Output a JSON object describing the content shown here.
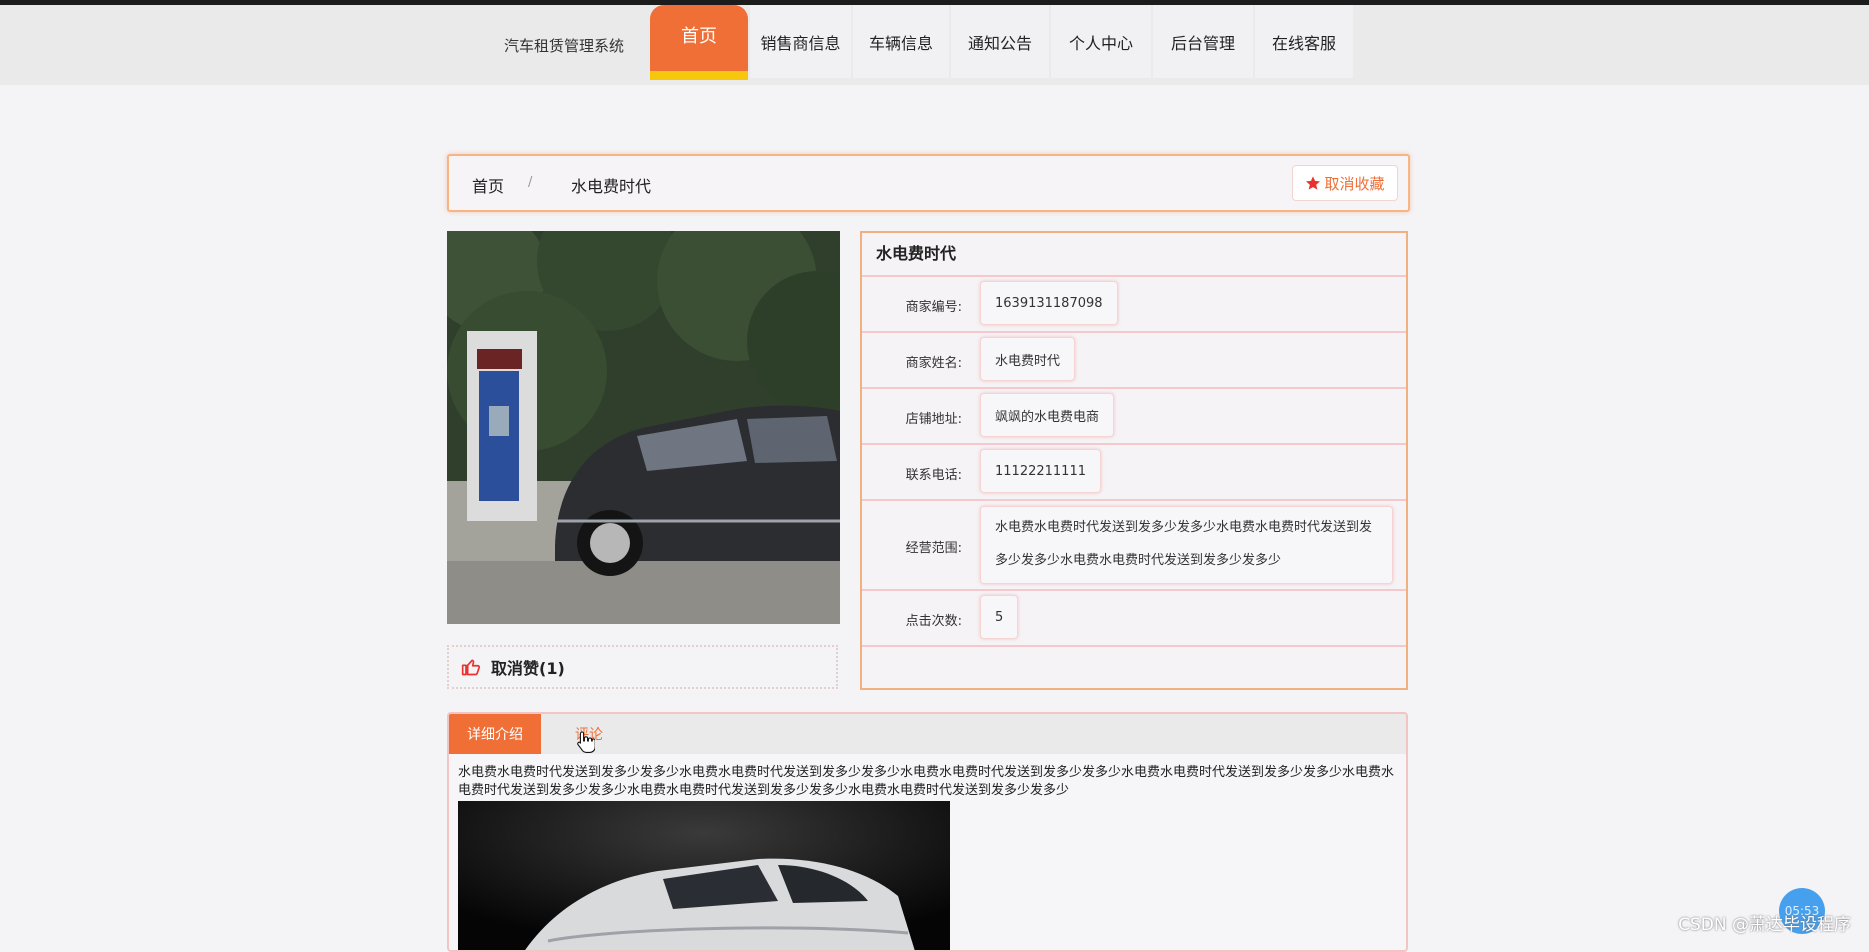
{
  "header": {
    "site_title": "汽车租赁管理系统",
    "nav": [
      {
        "label": "首页"
      },
      {
        "label": "销售商信息"
      },
      {
        "label": "车辆信息"
      },
      {
        "label": "通知公告"
      },
      {
        "label": "个人中心"
      },
      {
        "label": "后台管理"
      },
      {
        "label": "在线客服"
      }
    ]
  },
  "breadcrumb": {
    "home": "首页",
    "separator": "/",
    "current": "水电费时代",
    "favorite_button": "取消收藏"
  },
  "like": {
    "label": "取消赞(1)"
  },
  "info": {
    "title": "水电费时代",
    "rows": [
      {
        "label": "商家编号:",
        "value": "1639131187098"
      },
      {
        "label": "商家姓名:",
        "value": "水电费时代"
      },
      {
        "label": "店铺地址:",
        "value": "飒飒的水电费电商"
      },
      {
        "label": "联系电话:",
        "value": "11122211111"
      },
      {
        "label": "经营范围:",
        "value": "水电费水电费时代发送到发多少发多少水电费水电费时代发送到发多少发多少水电费水电费时代发送到发多少发多少"
      },
      {
        "label": "点击次数:",
        "value": "5"
      }
    ]
  },
  "tabs": {
    "detail": "详细介绍",
    "comment": "评论"
  },
  "description": "水电费水电费时代发送到发多少发多少水电费水电费时代发送到发多少发多少水电费水电费时代发送到发多少发多少水电费水电费时代发送到发多少发多少水电费水电费时代发送到发多少发多少水电费水电费时代发送到发多少发多少水电费水电费时代发送到发多少发多少",
  "overlay": {
    "timer": "05:53",
    "watermark": "CSDN @萧达毕设程序"
  },
  "colors": {
    "accent": "#f06f37",
    "accent_yellow": "#f7c70d",
    "border_orange": "#f0b07f",
    "border_pink": "#f5c8cc"
  }
}
